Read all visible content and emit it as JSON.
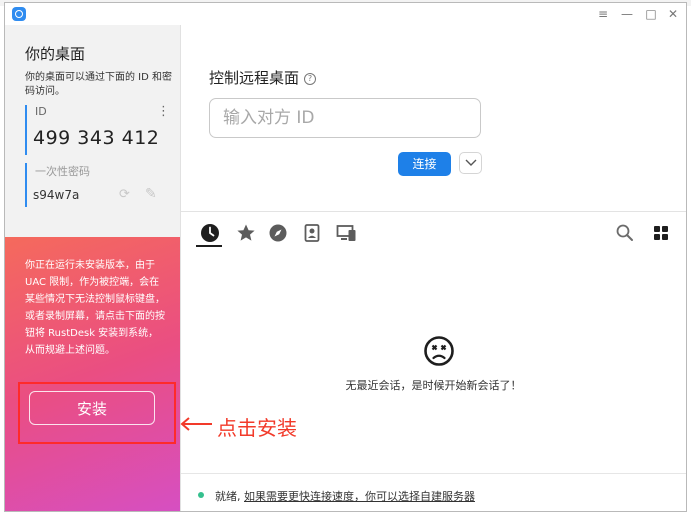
{
  "window": {
    "controls": [
      "≡",
      "—",
      "□",
      "✕"
    ]
  },
  "sidebar": {
    "title": "你的桌面",
    "description": "你的桌面可以通过下面的 ID 和密码访问。",
    "id_label": "ID",
    "id_value": "499 343 412",
    "menu_icon": "⋮",
    "password_label": "一次性密码",
    "password_value": "s94w7a",
    "warning_text": "你正在运行未安装版本，由于 UAC 限制，作为被控端，会在某些情况下无法控制鼠标键盘，或者录制屏幕，请点击下面的按钮将 RustDesk 安装到系统，从而规避上述问题。",
    "install_label": "安装"
  },
  "main": {
    "control_title": "控制远程桌面",
    "help_icon": "?",
    "id_placeholder": "输入对方 ID",
    "connect_label": "连接",
    "tabs": [
      "recent-sessions",
      "favorites",
      "discovered",
      "address-book",
      "group"
    ],
    "empty_text": "无最近会话，是时候开始新会话了！",
    "status_ready": "就绪,",
    "status_link": "如果需要更快连接速度，你可以选择自建服务器"
  },
  "annotation": {
    "label": "点击安装",
    "color": "#f23a2a"
  },
  "colors": {
    "accent": "#1e80e8",
    "warning_gradient_start": "#f56a5c",
    "warning_gradient_end": "#d64fc2",
    "status_ok": "#35c08e"
  }
}
